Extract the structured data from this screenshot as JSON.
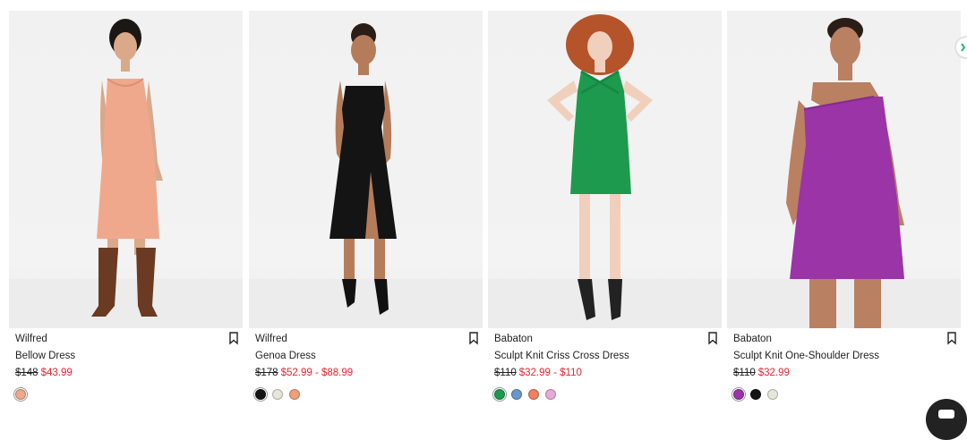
{
  "products": [
    {
      "brand": "Wilfred",
      "name": "Bellow Dress",
      "original_price": "$148",
      "sale_price": "$43.99",
      "dress_color": "#f0a88c",
      "swatches": [
        "#f0a88c"
      ],
      "model": {
        "skin": "#d9a98a",
        "hair": "#1b1714",
        "shoe": "#6b3a22",
        "style": "midi-boots"
      }
    },
    {
      "brand": "Wilfred",
      "name": "Genoa Dress",
      "original_price": "$178",
      "sale_price": "$52.99 - $88.99",
      "dress_color": "#141414",
      "swatches": [
        "#141414",
        "#e8e6da",
        "#f0a078"
      ],
      "model": {
        "skin": "#b57c5a",
        "hair": "#2a1e16",
        "shoe": "#111111",
        "style": "midi-heels"
      }
    },
    {
      "brand": "Babaton",
      "name": "Sculpt Knit Criss Cross Dress",
      "original_price": "$110",
      "sale_price": "$32.99 - $110",
      "dress_color": "#1e9a4e",
      "swatches": [
        "#1e9a4e",
        "#6a96c8",
        "#f08060",
        "#e8a8d8"
      ],
      "model": {
        "skin": "#f0d0bc",
        "hair": "#b5532a",
        "shoe": "#222222",
        "style": "mini-heels"
      }
    },
    {
      "brand": "Babaton",
      "name": "Sculpt Knit One-Shoulder Dress",
      "original_price": "$110",
      "sale_price": "$32.99",
      "dress_color": "#9b34a6",
      "swatches": [
        "#9b34a6",
        "#141414",
        "#e8e6da"
      ],
      "model": {
        "skin": "#b98062",
        "hair": "#2a1e16",
        "shoe": "#b98062",
        "style": "mini-crop"
      }
    }
  ],
  "icons": {
    "bookmark": "bookmark-icon",
    "next_arrow": "chevron-right-icon",
    "chat": "chat-icon"
  },
  "colors": {
    "sale": "#e3262f",
    "text": "#222222",
    "background": "#ffffff",
    "photo_bg": "#f1f1f1",
    "arrow_accent": "#2fb865"
  }
}
